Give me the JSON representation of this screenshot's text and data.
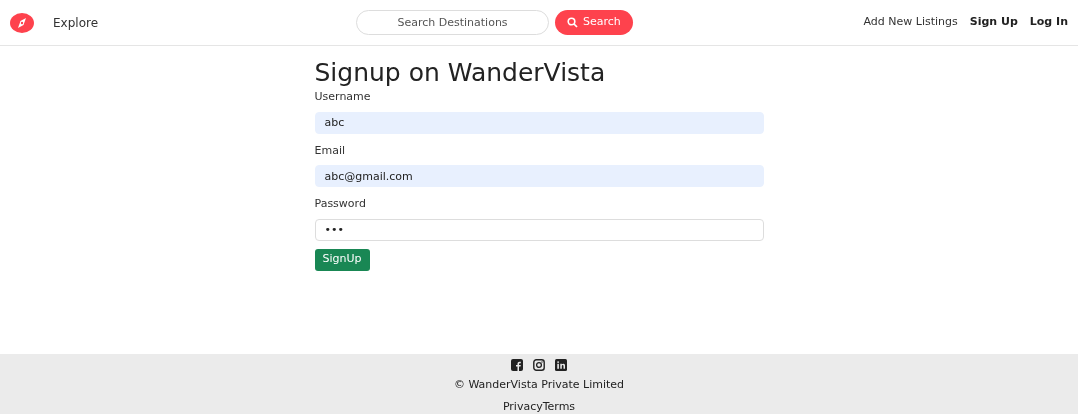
{
  "navbar": {
    "explore": "Explore",
    "search": {
      "placeholder": "Search Destinations",
      "button": "Search"
    },
    "links": [
      {
        "label": "Add New Listings",
        "bold": false
      },
      {
        "label": "Sign Up",
        "bold": true
      },
      {
        "label": "Log In",
        "bold": true
      }
    ]
  },
  "form": {
    "title": "Signup on WanderVista",
    "fields": [
      {
        "label": "Username",
        "value": "abc",
        "autofilled": true
      },
      {
        "label": "Email",
        "value": "abc@gmail.com",
        "autofilled": true
      },
      {
        "label": "Password",
        "value": "•••",
        "autofilled": false
      }
    ],
    "submit": "SignUp"
  },
  "footer": {
    "socials": [
      {
        "kind": "facebook"
      },
      {
        "kind": "instagram"
      },
      {
        "kind": "linkedin"
      }
    ],
    "copyright": "© WanderVista Private Limited",
    "links": [
      "Privacy",
      "Terms"
    ]
  }
}
